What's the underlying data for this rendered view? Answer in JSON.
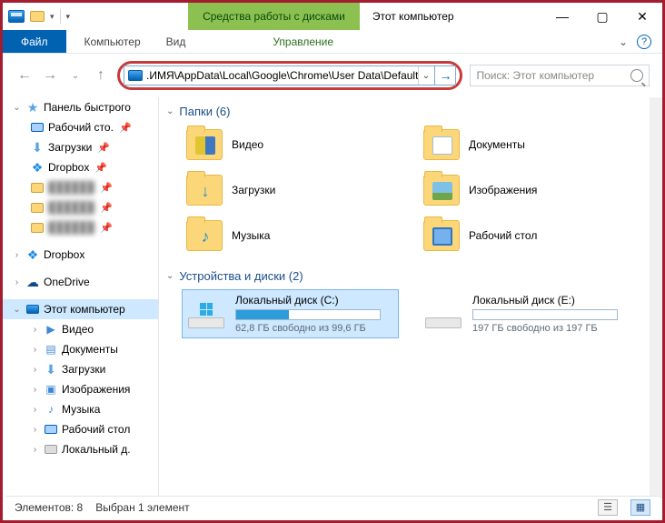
{
  "titlebar": {
    "ctx_tab": "Средства работы с дисками",
    "title": "Этот компьютер"
  },
  "ribbon": {
    "file": "Файл",
    "tabs": [
      "Компьютер",
      "Вид"
    ],
    "ctx_tabs": [
      "Управление"
    ]
  },
  "address": {
    "path": ".ИМЯ\\AppData\\Local\\Google\\Chrome\\User Data\\Default"
  },
  "search": {
    "placeholder": "Поиск: Этот компьютер"
  },
  "sidebar": {
    "quick_access": {
      "label": "Панель быстрого",
      "items": [
        {
          "label": "Рабочий сто.",
          "icon": "desktop",
          "pinned": true
        },
        {
          "label": "Загрузки",
          "icon": "download",
          "pinned": true
        },
        {
          "label": "Dropbox",
          "icon": "dropbox",
          "pinned": true
        },
        {
          "label": "",
          "icon": "folder",
          "pinned": true,
          "blur": true
        },
        {
          "label": "",
          "icon": "folder",
          "pinned": true,
          "blur": true
        },
        {
          "label": "",
          "icon": "folder",
          "pinned": true,
          "blur": true
        }
      ]
    },
    "dropbox": {
      "label": "Dropbox"
    },
    "onedrive": {
      "label": "OneDrive"
    },
    "this_pc": {
      "label": "Этот компьютер",
      "items": [
        {
          "label": "Видео",
          "icon": "video"
        },
        {
          "label": "Документы",
          "icon": "doc"
        },
        {
          "label": "Загрузки",
          "icon": "download"
        },
        {
          "label": "Изображения",
          "icon": "img"
        },
        {
          "label": "Музыка",
          "icon": "music"
        },
        {
          "label": "Рабочий стол",
          "icon": "desktop"
        },
        {
          "label": "Локальный д.",
          "icon": "disk"
        }
      ]
    }
  },
  "content": {
    "folders_header": "Папки (6)",
    "folders": [
      {
        "label": "Видео",
        "inner": "video"
      },
      {
        "label": "Документы",
        "inner": "doc"
      },
      {
        "label": "Загрузки",
        "inner": "dl"
      },
      {
        "label": "Изображения",
        "inner": "img"
      },
      {
        "label": "Музыка",
        "inner": "music"
      },
      {
        "label": "Рабочий стол",
        "inner": "desk"
      }
    ],
    "drives_header": "Устройства и диски (2)",
    "drives": [
      {
        "name": "Локальный диск (C:)",
        "sub": "62,8 ГБ свободно из 99,6 ГБ",
        "fill_pct": 37,
        "selected": true,
        "win_logo": true
      },
      {
        "name": "Локальный диск (E:)",
        "sub": "197 ГБ свободно из 197 ГБ",
        "fill_pct": 0,
        "selected": false,
        "win_logo": false
      }
    ]
  },
  "status": {
    "count": "Элементов: 8",
    "selected": "Выбран 1 элемент"
  }
}
